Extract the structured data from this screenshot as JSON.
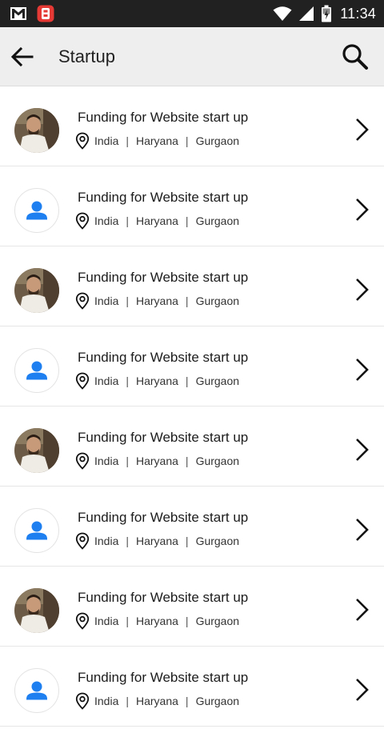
{
  "status_bar": {
    "time": "11:34",
    "colors": {
      "background": "#212121",
      "foreground": "#ffffff",
      "app_badge": "#e53935"
    }
  },
  "app_bar": {
    "title": "Startup",
    "colors": {
      "background": "#eeeeee"
    }
  },
  "list": {
    "items": [
      {
        "title": "Funding for Website start up",
        "country": "India",
        "state": "Haryana",
        "city": "Gurgaon",
        "avatar": "photo"
      },
      {
        "title": "Funding for Website start up",
        "country": "India",
        "state": "Haryana",
        "city": "Gurgaon",
        "avatar": "default-person"
      },
      {
        "title": "Funding for Website start up",
        "country": "India",
        "state": "Haryana",
        "city": "Gurgaon",
        "avatar": "photo"
      },
      {
        "title": "Funding for Website start up",
        "country": "India",
        "state": "Haryana",
        "city": "Gurgaon",
        "avatar": "default-person"
      },
      {
        "title": "Funding for Website start up",
        "country": "India",
        "state": "Haryana",
        "city": "Gurgaon",
        "avatar": "photo"
      },
      {
        "title": "Funding for Website start up",
        "country": "India",
        "state": "Haryana",
        "city": "Gurgaon",
        "avatar": "default-person"
      },
      {
        "title": "Funding for Website start up",
        "country": "India",
        "state": "Haryana",
        "city": "Gurgaon",
        "avatar": "photo"
      },
      {
        "title": "Funding for Website start up",
        "country": "India",
        "state": "Haryana",
        "city": "Gurgaon",
        "avatar": "default-person"
      }
    ],
    "separator": "|",
    "colors": {
      "person_icon": "#1e7ff0",
      "chevron": "#111111"
    }
  }
}
